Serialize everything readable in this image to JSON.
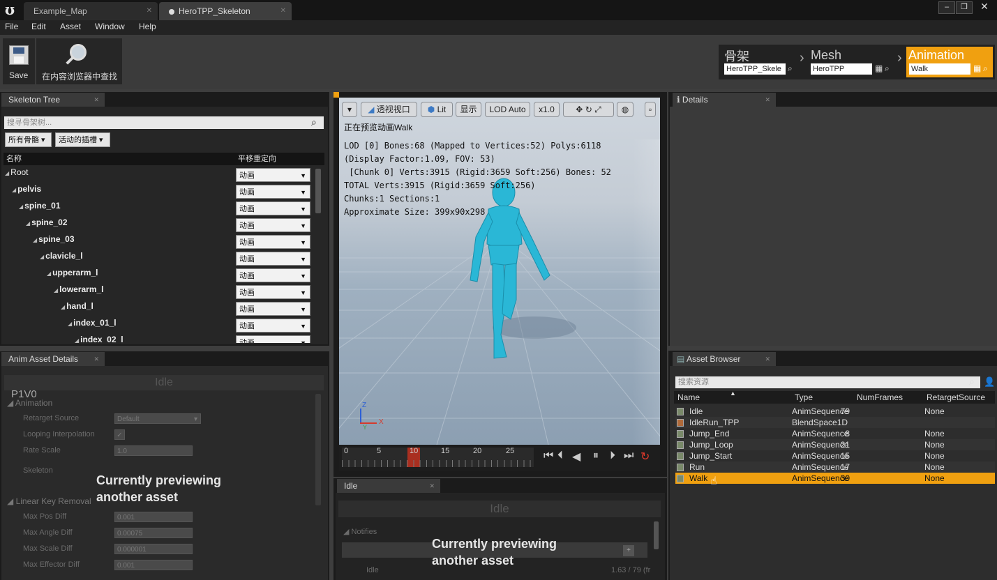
{
  "title_bar": {
    "tabs": [
      {
        "label": "Example_Map"
      },
      {
        "label": "HeroTPP_Skeleton"
      }
    ],
    "window_buttons": [
      "–",
      "❐",
      "✕"
    ]
  },
  "menu": [
    "File",
    "Edit",
    "Asset",
    "Window",
    "Help"
  ],
  "toolbar": {
    "save_label": "Save",
    "find_label": "在内容浏览器中查找"
  },
  "modes": {
    "skeleton": {
      "title": "骨架",
      "value": "HeroTPP_Skele"
    },
    "mesh": {
      "title": "Mesh",
      "value": "HeroTPP"
    },
    "animation": {
      "title": "Animation",
      "value": "Walk"
    }
  },
  "skeleton_tree": {
    "tab": "Skeleton Tree",
    "search_placeholder": "搜寻骨架树...",
    "filter_bones": "所有骨骼",
    "filter_sockets": "活动的插槽",
    "col_name": "名称",
    "col_retarget": "平移重定向",
    "bones": [
      {
        "name": "Root",
        "bold": false
      },
      {
        "name": "pelvis",
        "bold": true
      },
      {
        "name": "spine_01",
        "bold": true
      },
      {
        "name": "spine_02",
        "bold": true
      },
      {
        "name": "spine_03",
        "bold": true
      },
      {
        "name": "clavicle_l",
        "bold": true
      },
      {
        "name": "upperarm_l",
        "bold": true
      },
      {
        "name": "lowerarm_l",
        "bold": true
      },
      {
        "name": "hand_l",
        "bold": true
      },
      {
        "name": "index_01_l",
        "bold": true
      },
      {
        "name": "index_02_l",
        "bold": true
      }
    ],
    "retarget_value": "动画"
  },
  "anim_asset_details": {
    "tab": "Anim Asset Details",
    "header": "Idle",
    "p1v0": "P1V0",
    "section_animation": "Animation",
    "retarget_source_label": "Retarget Source",
    "retarget_source_value": "Default",
    "looping_label": "Looping Interpolation",
    "rate_scale_label": "Rate Scale",
    "rate_scale_value": "1.0",
    "skeleton_label": "Skeleton",
    "section_linear": "Linear Key Removal",
    "max_pos_label": "Max Pos Diff",
    "max_pos_value": "0.001",
    "max_angle_label": "Max Angle Diff",
    "max_angle_value": "0.00075",
    "max_scale_label": "Max Scale Diff",
    "max_scale_value": "0.000001",
    "max_effector_label": "Max Effector Diff",
    "max_effector_value": "0.001",
    "overlay_line1": "Currently previewing",
    "overlay_line2": "another asset"
  },
  "viewport": {
    "perspective": "透视视口",
    "lit": "Lit",
    "show": "显示",
    "lod": "LOD Auto",
    "speed": "x1.0",
    "previewing": "正在预览动画Walk",
    "stats": [
      "LOD [0] Bones:68 (Mapped to Vertices:52) Polys:6118",
      "(Display Factor:1.09, FOV: 53)",
      " [Chunk 0] Verts:3915 (Rigid:3659 Soft:256) Bones: 52",
      "TOTAL Verts:3915 (Rigid:3659 Soft:256)",
      "Chunks:1 Sections:1",
      "Approximate Size: 399x90x298"
    ],
    "axis_z": "Z",
    "axis_x": "X",
    "axis_y": "Y"
  },
  "timeline": {
    "ticks": [
      "0",
      "5",
      "10",
      "15",
      "20",
      "25"
    ],
    "current_frame": 10
  },
  "idle_panel": {
    "tab": "Idle",
    "header": "Idle",
    "notifies": "Notifies",
    "overlay_line1": "Currently previewing",
    "overlay_line2": "another asset",
    "status_left": "Idle",
    "status_right": "1.63 / 79 (fr"
  },
  "details": {
    "tab": "Details"
  },
  "asset_browser": {
    "tab": "Asset Browser",
    "search_placeholder": "搜索资源",
    "columns": [
      "Name",
      "Type",
      "NumFrames",
      "RetargetSource"
    ],
    "rows": [
      {
        "name": "Idle",
        "type": "AnimSequence",
        "frames": "79",
        "retarget": "None",
        "selected": false
      },
      {
        "name": "IdleRun_TPP",
        "type": "BlendSpace1D",
        "frames": "",
        "retarget": "",
        "selected": false
      },
      {
        "name": "Jump_End",
        "type": "AnimSequence",
        "frames": "8",
        "retarget": "None",
        "selected": false
      },
      {
        "name": "Jump_Loop",
        "type": "AnimSequence",
        "frames": "21",
        "retarget": "None",
        "selected": false
      },
      {
        "name": "Jump_Start",
        "type": "AnimSequence",
        "frames": "15",
        "retarget": "None",
        "selected": false
      },
      {
        "name": "Run",
        "type": "AnimSequence",
        "frames": "17",
        "retarget": "None",
        "selected": false
      },
      {
        "name": "Walk",
        "type": "AnimSequence",
        "frames": "30",
        "retarget": "None",
        "selected": true
      }
    ]
  },
  "colors": {
    "accent_orange": "#f0a010",
    "character_cyan": "#2ab7d6"
  }
}
